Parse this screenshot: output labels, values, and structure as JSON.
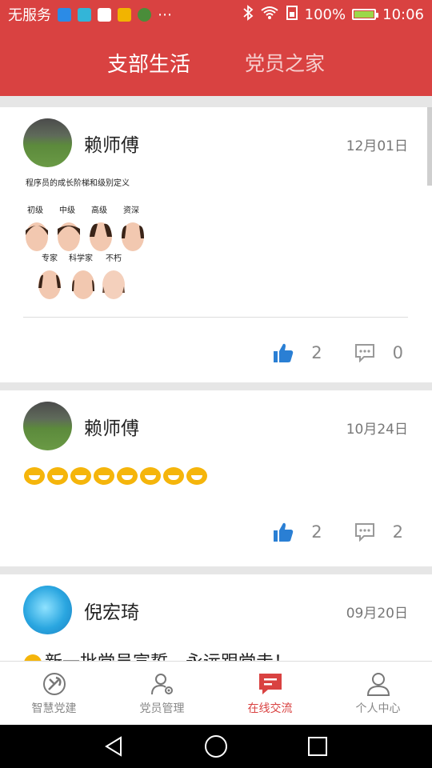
{
  "status_bar": {
    "carrier": "无服务",
    "battery": "100%",
    "time": "10:06"
  },
  "header": {
    "tabs": [
      {
        "label": "支部生活",
        "active": true
      },
      {
        "label": "党员之家",
        "active": false
      }
    ]
  },
  "posts": [
    {
      "author": "赖师傅",
      "date": "12月01日",
      "image": {
        "title": "程序员的成长阶梯和级别定义",
        "labels_top": [
          "初级",
          "中级",
          "高级",
          "资深"
        ],
        "labels_bottom": [
          "专家",
          "科学家",
          "不朽"
        ]
      },
      "likes": "2",
      "comments": "0"
    },
    {
      "author": "赖师傅",
      "date": "10月24日",
      "likes": "2",
      "comments": "2"
    },
    {
      "author": "倪宏琦",
      "date": "09月20日",
      "text": "新一批党员宣誓，永远跟党走！"
    }
  ],
  "bottom_nav": [
    {
      "label": "智慧党建",
      "icon": "party-emblem-icon",
      "active": false
    },
    {
      "label": "党员管理",
      "icon": "user-gear-icon",
      "active": false
    },
    {
      "label": "在线交流",
      "icon": "chat-icon",
      "active": true
    },
    {
      "label": "个人中心",
      "icon": "person-icon",
      "active": false
    }
  ],
  "colors": {
    "brand": "#d94241",
    "like": "#2a7fd4"
  }
}
